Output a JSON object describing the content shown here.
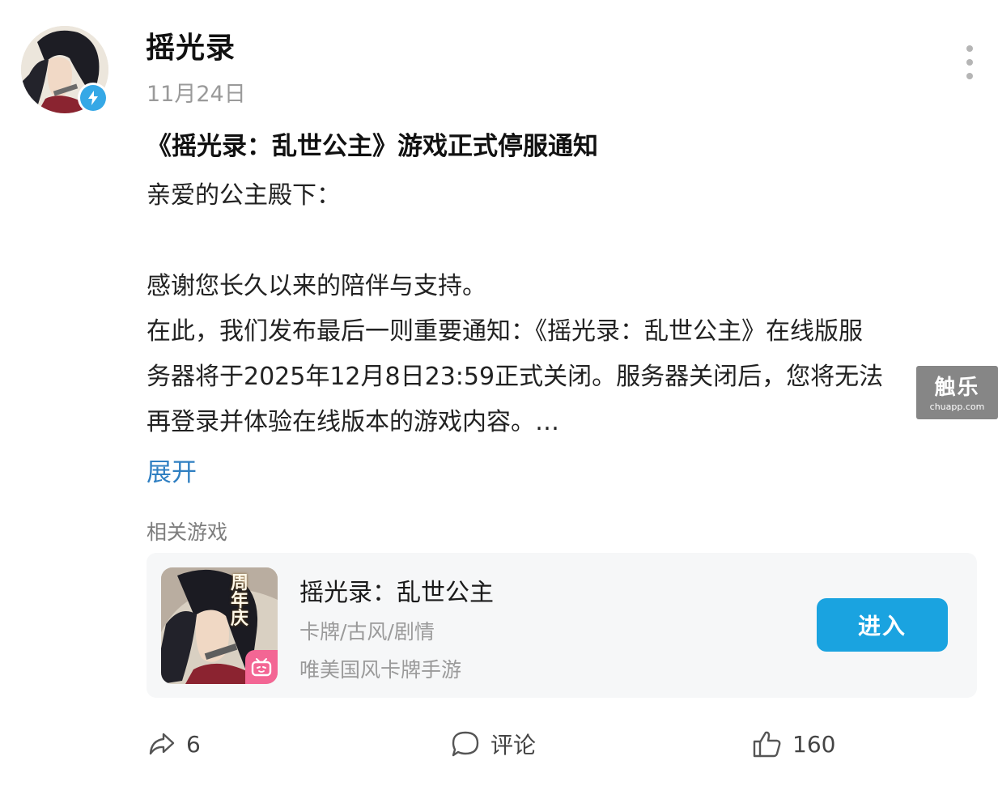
{
  "post": {
    "author": "摇光录",
    "date": "11月24日",
    "title": "《摇光录：乱世公主》游戏正式停服通知",
    "body_lines": [
      "亲爱的公主殿下：",
      "",
      "感谢您长久以来的陪伴与支持。",
      "在此，我们发布最后一则重要通知：《摇光录：乱世公主》在线版服",
      "务器将于2025年12月8日23:59正式关闭。服务器关闭后，您将无法",
      "再登录并体验在线版本的游戏内容。…"
    ],
    "expand_label": "展开"
  },
  "watermark": {
    "main": "触乐",
    "sub": "chuapp.com"
  },
  "related": {
    "label": "相关游戏",
    "game": {
      "name": "摇光录：乱世公主",
      "tags": "卡牌/古风/剧情",
      "description": "唯美国风卡牌手游",
      "icon_overlay": "周年庆",
      "enter_label": "进入"
    }
  },
  "actions": {
    "share_count": "6",
    "comment_label": "评论",
    "like_count": "160"
  },
  "icons": {
    "verify": "lightning-icon",
    "more": "more-vertical-icon",
    "share": "share-icon",
    "comment": "comment-icon",
    "like": "thumbs-up-icon",
    "bilibili": "bilibili-icon"
  },
  "colors": {
    "accent": "#1aa3e0",
    "link": "#2f7fc2",
    "verify_badge": "#35a8e6",
    "bilibili_pink": "#f36694"
  }
}
